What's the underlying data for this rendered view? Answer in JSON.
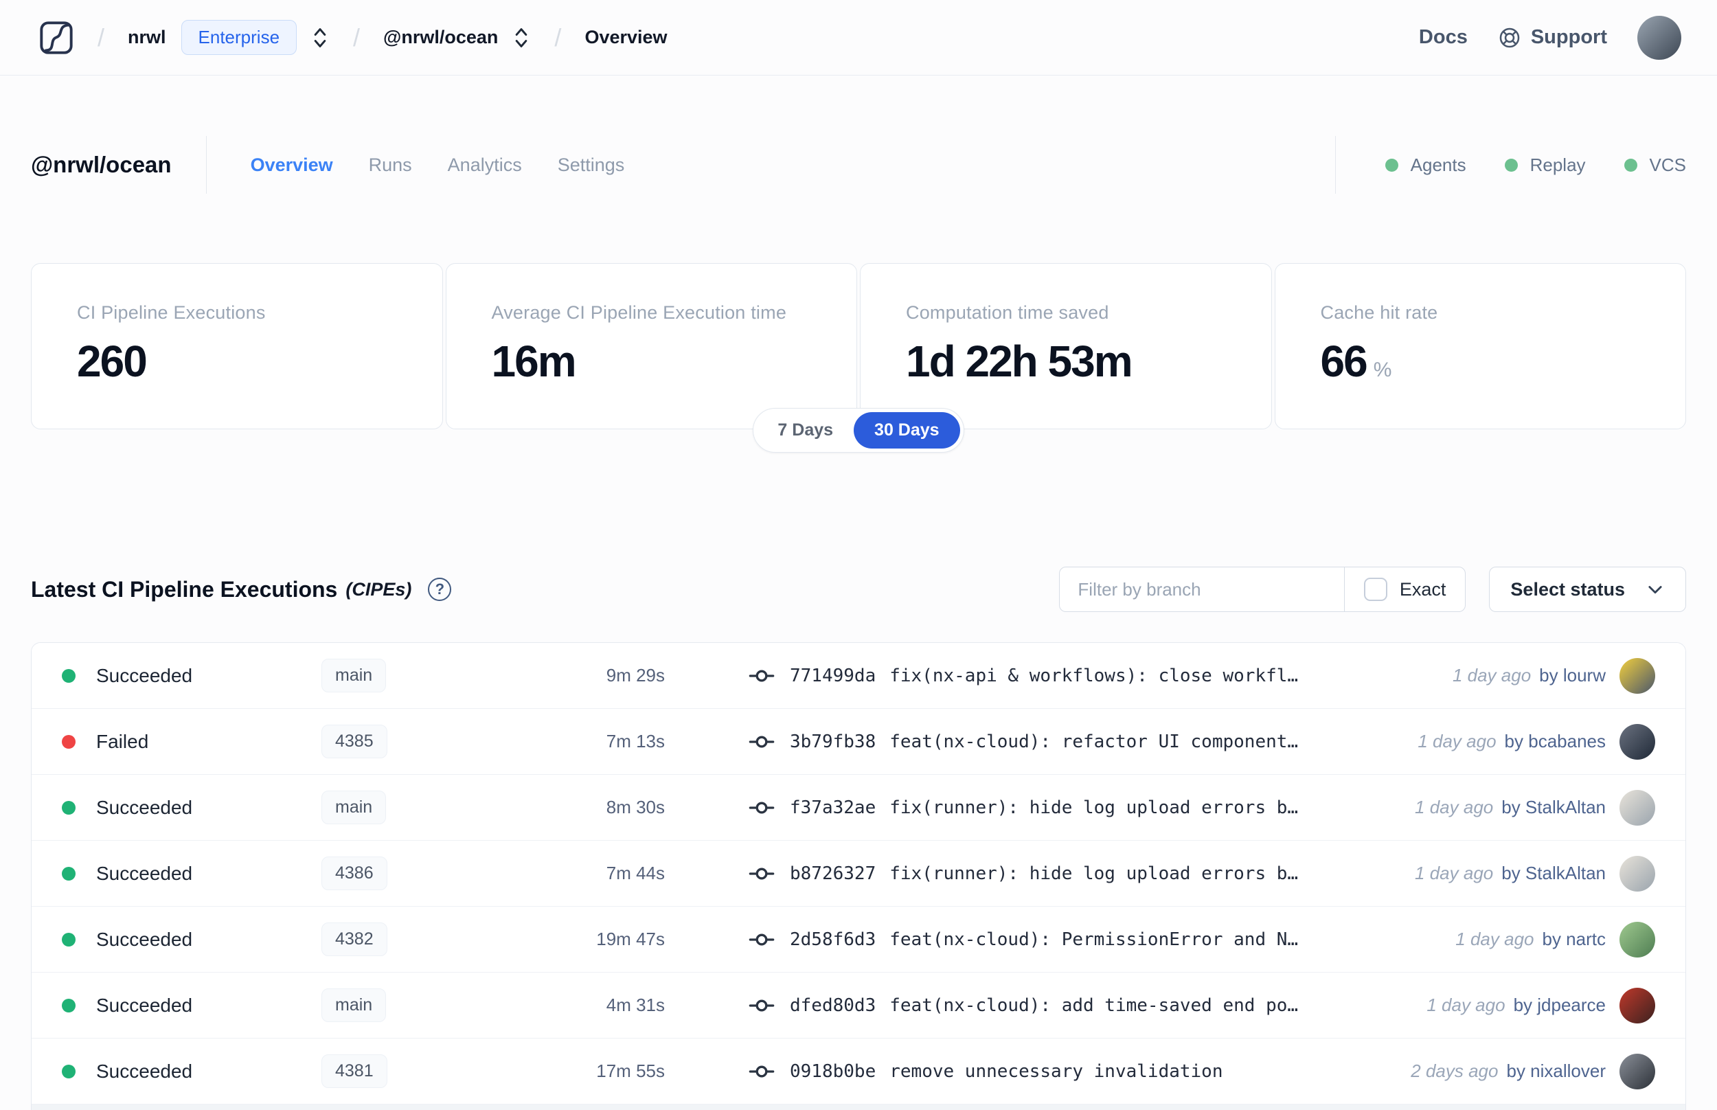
{
  "navbar": {
    "logo_icon": "nx-cloud-logo",
    "breadcrumb": {
      "separator": "/",
      "org": "nrwl",
      "org_badge": "Enterprise",
      "workspace": "@nrwl/ocean",
      "page": "Overview"
    },
    "links": {
      "docs": "Docs",
      "support": "Support"
    },
    "support_icon": "life-ring-icon",
    "avatar": {
      "c1": "#9aa5b1",
      "c2": "#3d4754"
    }
  },
  "header": {
    "title": "@nrwl/ocean",
    "tabs": [
      {
        "label": "Overview",
        "active": true
      },
      {
        "label": "Runs",
        "active": false
      },
      {
        "label": "Analytics",
        "active": false
      },
      {
        "label": "Settings",
        "active": false
      }
    ],
    "env": [
      {
        "label": "Agents"
      },
      {
        "label": "Replay"
      },
      {
        "label": "VCS"
      }
    ]
  },
  "stats": {
    "cards": [
      {
        "label": "CI Pipeline Executions",
        "value": "260",
        "suffix": ""
      },
      {
        "label": "Average CI Pipeline Execution time",
        "value": "16m",
        "suffix": ""
      },
      {
        "label": "Computation time saved",
        "value": "1d 22h 53m",
        "suffix": ""
      },
      {
        "label": "Cache hit rate",
        "value": "66",
        "suffix": "%"
      }
    ],
    "range_toggle": {
      "options": [
        "7 Days",
        "30 Days"
      ],
      "selected": "30 Days"
    }
  },
  "cipes": {
    "title": "Latest CI Pipeline Executions",
    "title_suffix": "(CIPEs)",
    "help_glyph": "?",
    "filter_placeholder": "Filter by branch",
    "exact_label": "Exact",
    "status_select_label": "Select status",
    "rows": [
      {
        "state": "succeeded",
        "status": "Succeeded",
        "branch": "main",
        "duration": "9m 29s",
        "hash": "771499da",
        "message": "fix(nx-api & workflows): close workfl…",
        "time_ago": "1 day ago",
        "author_label": "by lourw",
        "avatar": {
          "c1": "#f2cf3e",
          "c2": "#4a576b"
        }
      },
      {
        "state": "failed",
        "status": "Failed",
        "branch": "4385",
        "duration": "7m 13s",
        "hash": "3b79fb38",
        "message": "feat(nx-cloud): refactor UI component…",
        "time_ago": "1 day ago",
        "author_label": "by bcabanes",
        "avatar": {
          "c1": "#6b7280",
          "c2": "#1f2937"
        }
      },
      {
        "state": "succeeded",
        "status": "Succeeded",
        "branch": "main",
        "duration": "8m 30s",
        "hash": "f37a32ae",
        "message": "fix(runner): hide log upload errors b…",
        "time_ago": "1 day ago",
        "author_label": "by StalkAltan",
        "avatar": {
          "c1": "#e8e3da",
          "c2": "#9aa4ad"
        }
      },
      {
        "state": "succeeded",
        "status": "Succeeded",
        "branch": "4386",
        "duration": "7m 44s",
        "hash": "b8726327",
        "message": "fix(runner): hide log upload errors b…",
        "time_ago": "1 day ago",
        "author_label": "by StalkAltan",
        "avatar": {
          "c1": "#e8e3da",
          "c2": "#9aa4ad"
        }
      },
      {
        "state": "succeeded",
        "status": "Succeeded",
        "branch": "4382",
        "duration": "19m 47s",
        "hash": "2d58f6d3",
        "message": "feat(nx-cloud): PermissionError and N…",
        "time_ago": "1 day ago",
        "author_label": "by nartc",
        "avatar": {
          "c1": "#9fc98f",
          "c2": "#4e7d52"
        }
      },
      {
        "state": "succeeded",
        "status": "Succeeded",
        "branch": "main",
        "duration": "4m 31s",
        "hash": "dfed80d3",
        "message": "feat(nx-cloud): add time-saved end po…",
        "time_ago": "1 day ago",
        "author_label": "by jdpearce",
        "avatar": {
          "c1": "#c0392b",
          "c2": "#3b2220"
        }
      },
      {
        "state": "succeeded",
        "status": "Succeeded",
        "branch": "4381",
        "duration": "17m 55s",
        "hash": "0918b0be",
        "message": "remove unnecessary invalidation",
        "time_ago": "2 days ago",
        "author_label": "by nixallover",
        "avatar": {
          "c1": "#8a8f98",
          "c2": "#2c3138"
        }
      }
    ]
  },
  "colors": {
    "accent_blue": "#2563eb",
    "active_tab_blue": "#3b82f6",
    "selected_pill_blue": "#2c5cdb",
    "success_green": "#1fb275",
    "failed_red": "#ef4444",
    "env_dot_green": "#6cc08f"
  }
}
